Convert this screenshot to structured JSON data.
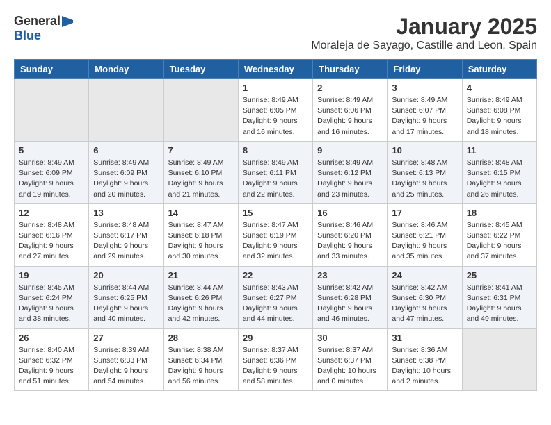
{
  "header": {
    "logo_general": "General",
    "logo_blue": "Blue",
    "month_title": "January 2025",
    "location": "Moraleja de Sayago, Castille and Leon, Spain"
  },
  "calendar": {
    "weekdays": [
      "Sunday",
      "Monday",
      "Tuesday",
      "Wednesday",
      "Thursday",
      "Friday",
      "Saturday"
    ],
    "weeks": [
      [
        {
          "day": "",
          "info": ""
        },
        {
          "day": "",
          "info": ""
        },
        {
          "day": "",
          "info": ""
        },
        {
          "day": "1",
          "info": "Sunrise: 8:49 AM\nSunset: 6:05 PM\nDaylight: 9 hours and 16 minutes."
        },
        {
          "day": "2",
          "info": "Sunrise: 8:49 AM\nSunset: 6:06 PM\nDaylight: 9 hours and 16 minutes."
        },
        {
          "day": "3",
          "info": "Sunrise: 8:49 AM\nSunset: 6:07 PM\nDaylight: 9 hours and 17 minutes."
        },
        {
          "day": "4",
          "info": "Sunrise: 8:49 AM\nSunset: 6:08 PM\nDaylight: 9 hours and 18 minutes."
        }
      ],
      [
        {
          "day": "5",
          "info": "Sunrise: 8:49 AM\nSunset: 6:09 PM\nDaylight: 9 hours and 19 minutes."
        },
        {
          "day": "6",
          "info": "Sunrise: 8:49 AM\nSunset: 6:09 PM\nDaylight: 9 hours and 20 minutes."
        },
        {
          "day": "7",
          "info": "Sunrise: 8:49 AM\nSunset: 6:10 PM\nDaylight: 9 hours and 21 minutes."
        },
        {
          "day": "8",
          "info": "Sunrise: 8:49 AM\nSunset: 6:11 PM\nDaylight: 9 hours and 22 minutes."
        },
        {
          "day": "9",
          "info": "Sunrise: 8:49 AM\nSunset: 6:12 PM\nDaylight: 9 hours and 23 minutes."
        },
        {
          "day": "10",
          "info": "Sunrise: 8:48 AM\nSunset: 6:13 PM\nDaylight: 9 hours and 25 minutes."
        },
        {
          "day": "11",
          "info": "Sunrise: 8:48 AM\nSunset: 6:15 PM\nDaylight: 9 hours and 26 minutes."
        }
      ],
      [
        {
          "day": "12",
          "info": "Sunrise: 8:48 AM\nSunset: 6:16 PM\nDaylight: 9 hours and 27 minutes."
        },
        {
          "day": "13",
          "info": "Sunrise: 8:48 AM\nSunset: 6:17 PM\nDaylight: 9 hours and 29 minutes."
        },
        {
          "day": "14",
          "info": "Sunrise: 8:47 AM\nSunset: 6:18 PM\nDaylight: 9 hours and 30 minutes."
        },
        {
          "day": "15",
          "info": "Sunrise: 8:47 AM\nSunset: 6:19 PM\nDaylight: 9 hours and 32 minutes."
        },
        {
          "day": "16",
          "info": "Sunrise: 8:46 AM\nSunset: 6:20 PM\nDaylight: 9 hours and 33 minutes."
        },
        {
          "day": "17",
          "info": "Sunrise: 8:46 AM\nSunset: 6:21 PM\nDaylight: 9 hours and 35 minutes."
        },
        {
          "day": "18",
          "info": "Sunrise: 8:45 AM\nSunset: 6:22 PM\nDaylight: 9 hours and 37 minutes."
        }
      ],
      [
        {
          "day": "19",
          "info": "Sunrise: 8:45 AM\nSunset: 6:24 PM\nDaylight: 9 hours and 38 minutes."
        },
        {
          "day": "20",
          "info": "Sunrise: 8:44 AM\nSunset: 6:25 PM\nDaylight: 9 hours and 40 minutes."
        },
        {
          "day": "21",
          "info": "Sunrise: 8:44 AM\nSunset: 6:26 PM\nDaylight: 9 hours and 42 minutes."
        },
        {
          "day": "22",
          "info": "Sunrise: 8:43 AM\nSunset: 6:27 PM\nDaylight: 9 hours and 44 minutes."
        },
        {
          "day": "23",
          "info": "Sunrise: 8:42 AM\nSunset: 6:28 PM\nDaylight: 9 hours and 46 minutes."
        },
        {
          "day": "24",
          "info": "Sunrise: 8:42 AM\nSunset: 6:30 PM\nDaylight: 9 hours and 47 minutes."
        },
        {
          "day": "25",
          "info": "Sunrise: 8:41 AM\nSunset: 6:31 PM\nDaylight: 9 hours and 49 minutes."
        }
      ],
      [
        {
          "day": "26",
          "info": "Sunrise: 8:40 AM\nSunset: 6:32 PM\nDaylight: 9 hours and 51 minutes."
        },
        {
          "day": "27",
          "info": "Sunrise: 8:39 AM\nSunset: 6:33 PM\nDaylight: 9 hours and 54 minutes."
        },
        {
          "day": "28",
          "info": "Sunrise: 8:38 AM\nSunset: 6:34 PM\nDaylight: 9 hours and 56 minutes."
        },
        {
          "day": "29",
          "info": "Sunrise: 8:37 AM\nSunset: 6:36 PM\nDaylight: 9 hours and 58 minutes."
        },
        {
          "day": "30",
          "info": "Sunrise: 8:37 AM\nSunset: 6:37 PM\nDaylight: 10 hours and 0 minutes."
        },
        {
          "day": "31",
          "info": "Sunrise: 8:36 AM\nSunset: 6:38 PM\nDaylight: 10 hours and 2 minutes."
        },
        {
          "day": "",
          "info": ""
        }
      ]
    ]
  }
}
